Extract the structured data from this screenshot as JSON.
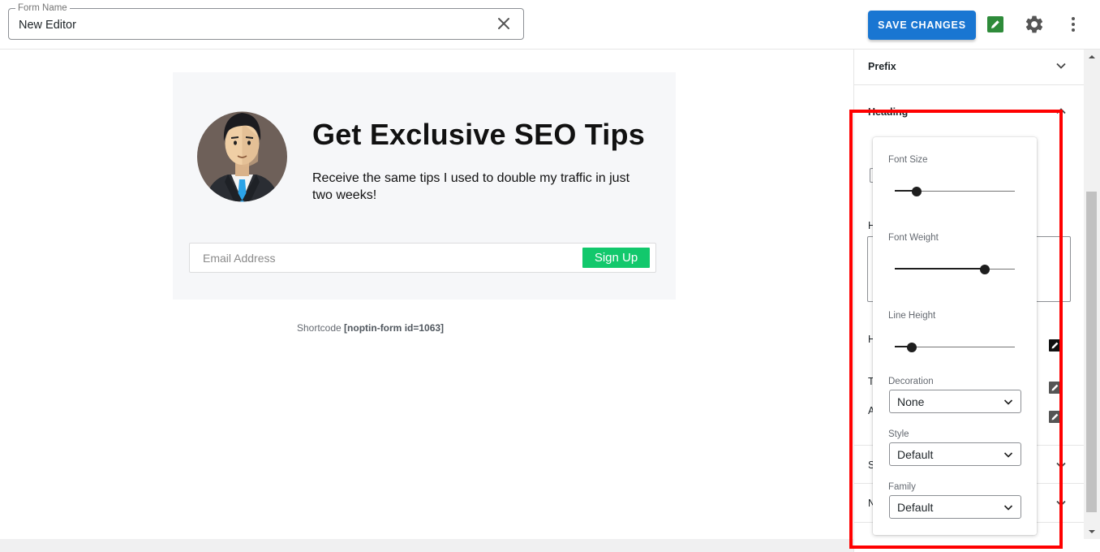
{
  "topbar": {
    "form_name_label": "Form Name",
    "form_name_value": "New Editor",
    "save_label": "SAVE CHANGES"
  },
  "preview": {
    "heading": "Get Exclusive SEO Tips",
    "description": "Receive the same tips I used to double my traffic in just two weeks!",
    "email_placeholder": "Email Address",
    "signup_label": "Sign Up",
    "shortcode_label": "Shortcode",
    "shortcode_value": "[noptin-form id=1063]"
  },
  "sidebar": {
    "sections": [
      {
        "label": "Prefix"
      },
      {
        "label": "Heading"
      }
    ],
    "ghost_letters": [
      "H",
      "H",
      "T",
      "A",
      "S",
      "N"
    ]
  },
  "heading_popover": {
    "font_size_label": "Font Size",
    "font_size_fraction": 0.18,
    "font_weight_label": "Font Weight",
    "font_weight_fraction": 0.75,
    "line_height_label": "Line Height",
    "line_height_fraction": 0.14,
    "decoration_label": "Decoration",
    "decoration_value": "None",
    "style_label": "Style",
    "style_value": "Default",
    "family_label": "Family",
    "family_value": "Default"
  },
  "colors": {
    "primary_button": "#1976d2",
    "signup_button": "#12c86c",
    "highlight": "#ff0000",
    "edit_icon": "#2e8b3a"
  }
}
